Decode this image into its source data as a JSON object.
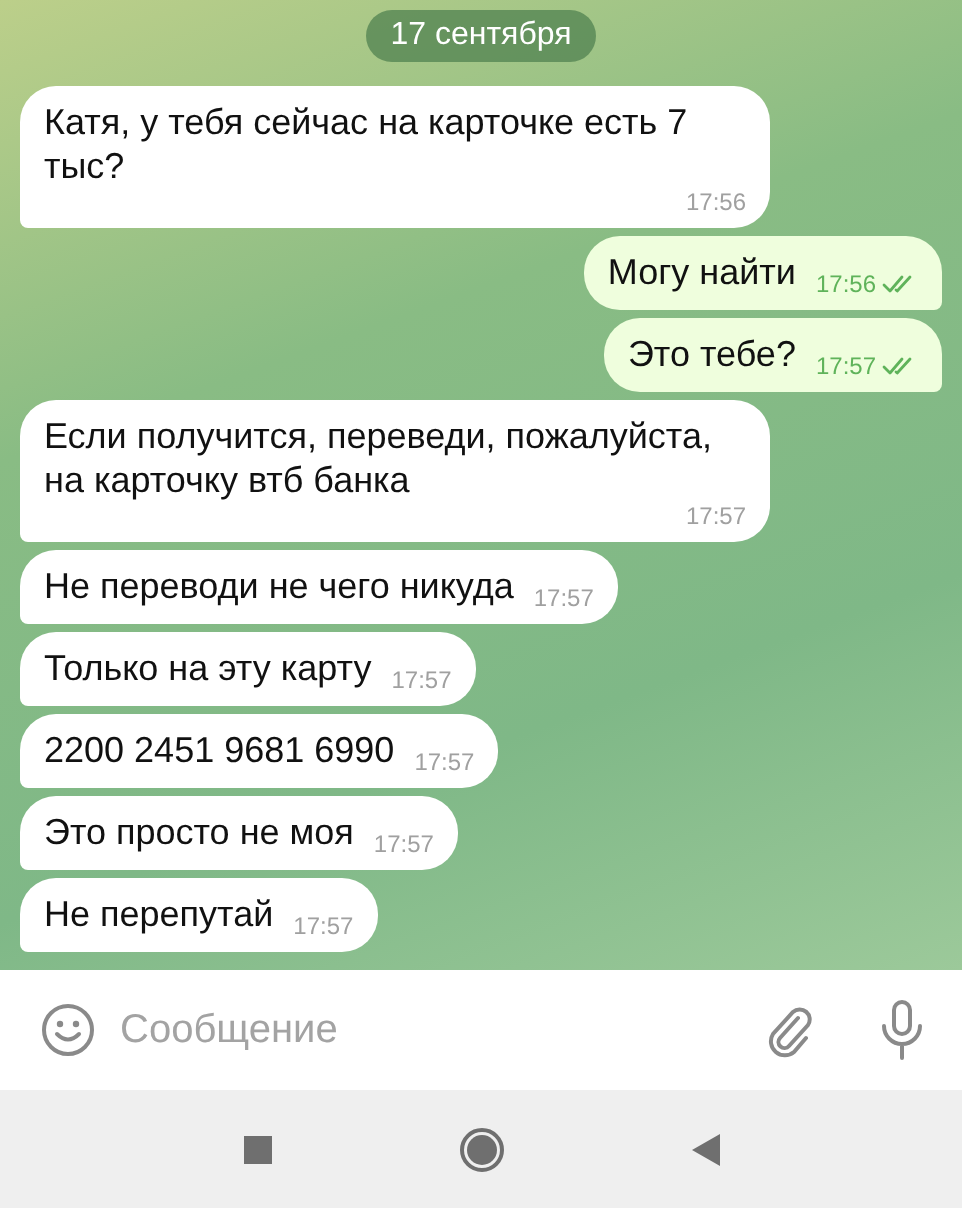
{
  "date_pill": "17 сентября",
  "messages": [
    {
      "text": "Катя, у тебя сейчас на карточке есть 7 тыс?",
      "time": "17:56",
      "outgoing": false
    },
    {
      "text": "Могу найти",
      "time": "17:56",
      "outgoing": true,
      "read": true
    },
    {
      "text": "Это тебе?",
      "time": "17:57",
      "outgoing": true,
      "read": true
    },
    {
      "text": "Если получится, переведи, пожалуйста, на карточку втб банка",
      "time": "17:57",
      "outgoing": false
    },
    {
      "text": "Не переводи не чего никуда",
      "time": "17:57",
      "outgoing": false
    },
    {
      "text": "Только на эту карту",
      "time": "17:57",
      "outgoing": false
    },
    {
      "text": "2200 2451 9681 6990",
      "time": "17:57",
      "outgoing": false
    },
    {
      "text": "Это просто не моя",
      "time": "17:57",
      "outgoing": false
    },
    {
      "text": "Не перепутай",
      "time": "17:57",
      "outgoing": false
    }
  ],
  "composer": {
    "placeholder": "Сообщение"
  }
}
